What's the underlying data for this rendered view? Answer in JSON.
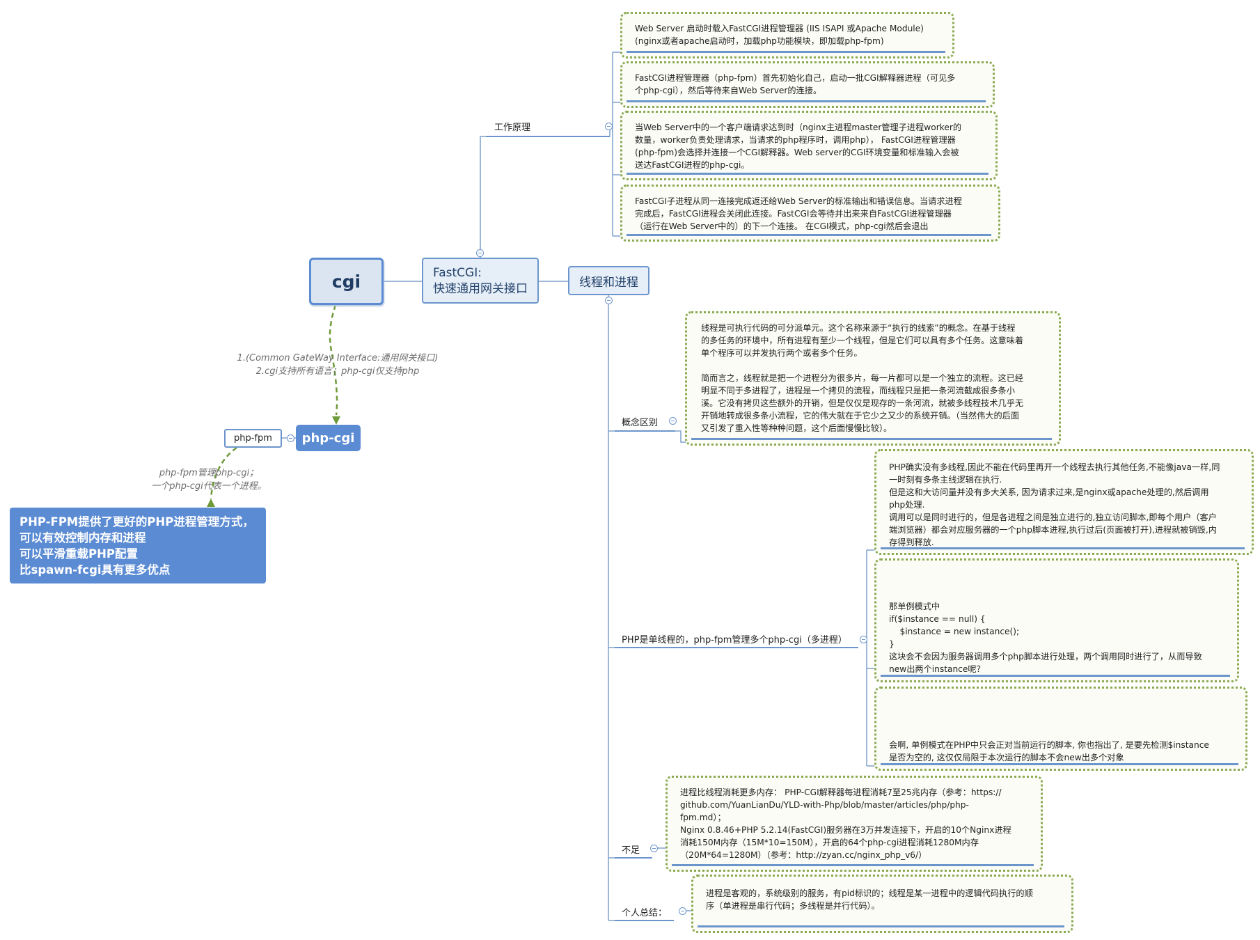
{
  "nodes": {
    "cgi": "cgi",
    "fastcgi_line1": "FastCGI:",
    "fastcgi_line2": "快速通用网关接口",
    "thread_process": "线程和进程",
    "php_cgi": "php-cgi",
    "php_fpm": "php-fpm",
    "php_fpm_benefits": [
      "PHP-FPM提供了更好的PHP进程管理方式，",
      "可以有效控制内存和进程",
      "可以平滑重载PHP配置",
      "比spawn-fcgi具有更多优点"
    ]
  },
  "relations": {
    "cgi_to_phpcgi": [
      "1.(Common GateWay Interface:通用网关接口)",
      "2.cgi支持所有语言；php-cgi仅支持php"
    ],
    "fpm_to_benefits": [
      "php-fpm管理php-cgi；",
      "一个php-cgi代表一个进程。"
    ]
  },
  "branches": {
    "working_principle": "工作原理",
    "concept_diff": "概念区别",
    "php_single_thread": "PHP是单线程的，php-fpm管理多个php-cgi（多进程）",
    "shortcoming": "不足",
    "personal_summary": "个人总结："
  },
  "notes": {
    "wp1": "Web Server 启动时载入FastCGI进程管理器 (IIS ISAPI 或Apache Module)\n(nginx或者apache启动时，加载php功能模块，即加载php-fpm)",
    "wp2": "FastCGI进程管理器（php-fpm）首先初始化自己，启动一批CGI解释器进程（可见多\n个php-cgi），然后等待来自Web Server的连接。",
    "wp3": "当Web Server中的一个客户端请求达到时（nginx主进程master管理子进程worker的\n数量，worker负责处理请求，当请求的php程序时，调用php）， FastCGI进程管理器\n(php-fpm)会选择并连接一个CGI解释器。Web server的CGI环境变量和标准输入会被\n送达FastCGI进程的php-cgi。",
    "wp4": "FastCGI子进程从同一连接完成返还给Web Server的标准输出和错误信息。当请求进程\n完成后，FastCGI进程会关闭此连接。FastCGI会等待并出来来自FastCGI进程管理器\n（运行在Web Server中的）的下一个连接。 在CGI模式，php-cgi然后会退出",
    "concept": "线程是可执行代码的可分派单元。这个名称来源于“执行的线索”的概念。在基于线程\n的多任务的环境中，所有进程有至少一个线程，但是它们可以具有多个任务。这意味着\n单个程序可以并发执行两个或者多个任务。\n\n简而言之，线程就是把一个进程分为很多片，每一片都可以是一个独立的流程。这已经\n明显不同于多进程了，进程是一个拷贝的流程，而线程只是把一条河流截成很多条小\n溪。它没有拷贝这些额外的开销，但是仅仅是现存的一条河流，就被多线程技术几乎无\n开销地转成很多条小流程，它的伟大就在于它少之又少的系统开销。（当然伟大的后面\n又引发了重入性等种种问题，这个后面慢慢比较）。",
    "php1": "PHP确实没有多线程,因此不能在代码里再开一个线程去执行其他任务,不能像java一样,同\n一时刻有多条主线逻辑在执行.\n但是这和大访问量并没有多大关系, 因为请求过来,是nginx或apache处理的,然后调用\nphp处理.\n调用可以是同时进行的，但是各进程之间是独立进行的,独立访问脚本,即每个用户（客户\n端浏览器）都会对应服务器的一个php脚本进程,执行过后(页面被打开),进程就被销毁,内\n存得到释放.",
    "php2": "那单例模式中\nif($instance == null) {\n    $instance = new instance();\n}\n这块会不会因为服务器调用多个php脚本进行处理，两个调用同时进行了，从而导致\nnew出两个instance呢？",
    "php3": "会啊, 单例模式在PHP中只会正对当前运行的脚本, 你也指出了, 是要先检测$instance\n是否为空的, 这仅仅局限于本次运行的脚本不会new出多个对象",
    "short": "进程比线程消耗更多内存： PHP-CGI解释器每进程消耗7至25兆内存（参考：https://\ngithub.com/YuanLianDu/YLD-with-Php/blob/master/articles/php/php-\nfpm.md）；\nNginx 0.8.46+PHP 5.2.14(FastCGI)服务器在3万并发连接下，开启的10个Nginx进程\n消耗150M内存（15M*10=150M），开启的64个php-cgi进程消耗1280M内存\n（20M*64=1280M）（参考：http://zyan.cc/nginx_php_v6/）",
    "summary": "进程是客观的，系统级别的服务，有pid标识的；线程是某一进程中的逻辑代码执行的顺\n序（单进程是串行代码；多线程是并行代码）。"
  },
  "colors": {
    "connector": "#7ea0cc",
    "dashed_relation": "#6e9a3a",
    "note_border": "#8aaa52",
    "accent_blue": "#5b8bd3"
  }
}
